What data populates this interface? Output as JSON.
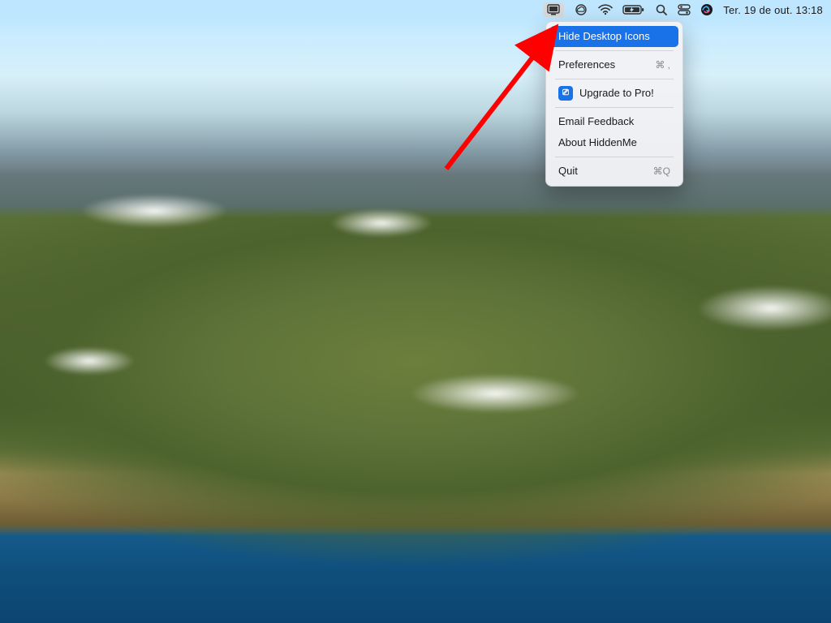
{
  "menubar": {
    "date_time": "Ter. 19 de out.  13:18",
    "icons": {
      "hiddenme": "hiddenme-status-icon",
      "creative_cloud": "creative-cloud-icon",
      "wifi": "wifi-icon",
      "battery": "battery-charging-icon",
      "spotlight": "spotlight-icon",
      "control_center": "control-center-icon",
      "siri": "siri-icon"
    }
  },
  "dropdown": {
    "hide_desktop_icons": "Hide Desktop Icons",
    "preferences": {
      "label": "Preferences",
      "shortcut": "⌘ ,"
    },
    "upgrade": "Upgrade to Pro!",
    "email_feedback": "Email Feedback",
    "about": "About HiddenMe",
    "quit": {
      "label": "Quit",
      "shortcut": "⌘Q"
    }
  },
  "annotation": {
    "arrow_color": "#ff0000"
  }
}
